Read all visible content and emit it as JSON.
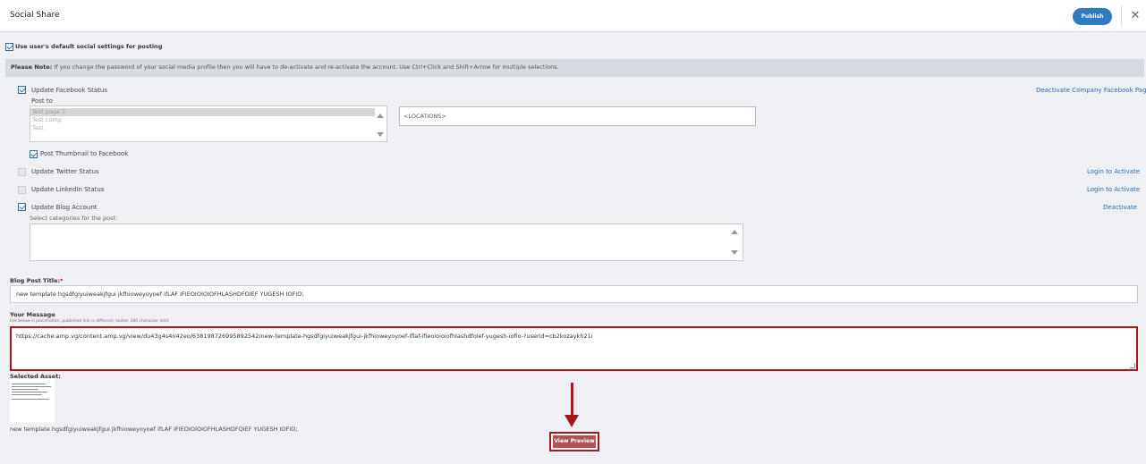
{
  "header": {
    "title": "Social Share",
    "publish_label": "Publish",
    "close_glyph": "✕"
  },
  "default_settings": {
    "label": "Use user's default social settings for posting",
    "checked": true
  },
  "note": {
    "label": "Please Note:",
    "text": "If you change the password of your social media profile then you will have to de-activate and re-activate the account. Use Ctrl+Click and Shift+Arrow for multiple selections."
  },
  "facebook": {
    "label": "Update Facebook Status",
    "checked": true,
    "deactivate_link": "Deactivate Company Facebook Page",
    "post_to_label": "Post to",
    "pages": [
      "Test page 2",
      "Test comp",
      "Test"
    ],
    "selected_page": "Test page 2",
    "locations_value": "<LOCATIONS>",
    "thumbnail_label": "Post Thumbnail to Facebook",
    "thumbnail_checked": true
  },
  "twitter": {
    "label": "Update Twitter Status",
    "checked": false,
    "link": "Login to Activate"
  },
  "linkedin": {
    "label": "Update LinkedIn Status",
    "checked": false,
    "link": "Login to Activate"
  },
  "blog": {
    "label": "Update Blog Account",
    "checked": true,
    "link": "Deactivate",
    "categories_label": "Select categories for the post:"
  },
  "blog_title": {
    "label": "Blog Post Title:",
    "required_mark": "*",
    "value": "new template hgsdfgiyuiweakjfgui jkfhioweyoyoef ifLAF IFIEOIOIOIOFHLASHDFOIEF YUGESH IOFIO;"
  },
  "message": {
    "label": "Your Message",
    "hint": "link below is placeholder, published link is different; twitter 280 character limit",
    "value": "https://cache.amp.vg/content.amp.vg/view/du43g4s4n42eo/638198726995892542/new-template-hgsdfgiyuiweakjfgui-jkfhioweyoyoef-iflaf-ifieoioioiofhlashdfoief-yugesh-iofio-?userid=cb2kozaykh21i"
  },
  "asset": {
    "label": "Selected Asset:",
    "caption": "new template hgsdfgiyuiweakjfgui jkfhioweyoyoef ifLAF IFIEOIOIOIOFHLASHDFOIEF YUGESH IOFIO;"
  },
  "preview": {
    "label": "View Preview"
  },
  "colors": {
    "accent_blue": "#2f7bc1",
    "highlight_red": "#a8151c",
    "preview_button": "#b05353"
  }
}
